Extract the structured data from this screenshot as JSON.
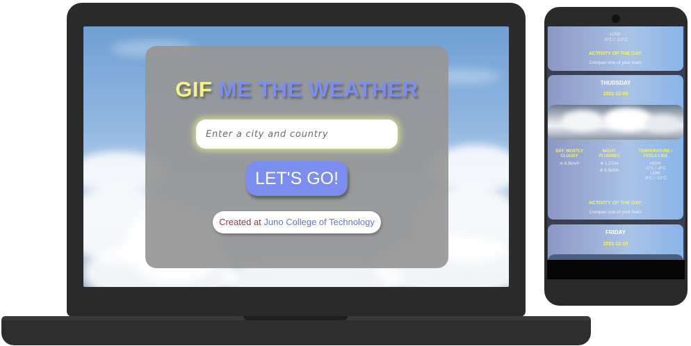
{
  "app": {
    "title_part1": "GIF",
    "title_part2": "ME THE WEATHER",
    "city_placeholder": "Enter a city and country",
    "go_label": "LET'S GO!",
    "credit_prefix": "Created at",
    "credit_link": "Juno College of Technology"
  },
  "mobile": {
    "cards": [
      {
        "partial_top": "LOW:",
        "partial_temp": "-9°C / -13°C",
        "activity_label": "ACTIVITY OF THE DAY:",
        "activity_text": "Conquer one of your fears"
      },
      {
        "day": "THURSDAY",
        "date": "2021-12-09",
        "day_label": "DAY: MOSTLY CLOUDY",
        "night_label": "NIGHT: FLURRIES",
        "temp_label": "TEMPERATURE / FEELS LIKE",
        "day_wind": "9.3km/h",
        "night_snow": "1.27cm",
        "night_wind": "3.3km/h",
        "high_label": "HIGH:",
        "high_temp": "-5°C / -9°C",
        "low_label": "LOW:",
        "low_temp": "-6°C / -12°C",
        "activity_label": "ACTIVITY OF THE DAY:",
        "activity_text": "Conquer one of your fears"
      },
      {
        "day": "FRIDAY",
        "date": "2021-12-10"
      }
    ]
  },
  "colors": {
    "title_yellow": "#f6f28a",
    "accent_blue": "#7b8ef0",
    "card_gray": "#969696",
    "laptop_body": "#2b2b2b"
  }
}
